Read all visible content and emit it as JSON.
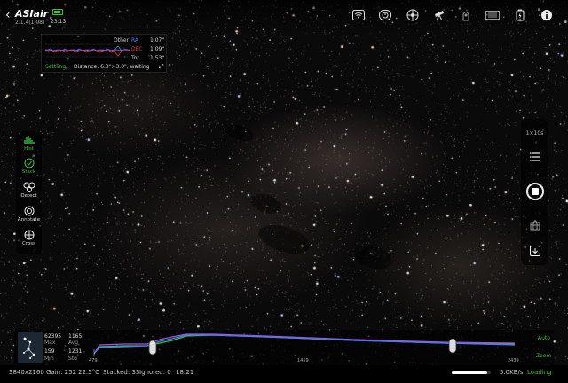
{
  "header": {
    "back_glyph": "‹",
    "brand": "ASIair",
    "version": "2.1.4(1.08)",
    "time": "23:13",
    "icons": [
      "wifi-icon",
      "power-icon",
      "guide-icon",
      "telescope-icon",
      "camera-icon",
      "cooling-icon",
      "battery-device-icon",
      "info-icon"
    ]
  },
  "guide": {
    "labels": {
      "other": "Other",
      "ra": "RA",
      "dec": "DEC",
      "tot": "Tot"
    },
    "values": {
      "other": "1.07\"",
      "ra": "1.09\"",
      "dec": "1.53\""
    },
    "status": "Settling",
    "distance": "Distance: 6.3\">3.0\", waiting",
    "colors": {
      "ra": "#3b82f6",
      "dec": "#e53935",
      "ok": "#3fbf3f"
    }
  },
  "left_tools": [
    {
      "label": "Hist",
      "icon": "histogram-icon",
      "active": true
    },
    {
      "label": "Stack",
      "icon": "stack-icon",
      "active": true
    },
    {
      "label": "Detect",
      "icon": "detect-icon",
      "active": false
    },
    {
      "label": "Annotate",
      "icon": "annotate-icon",
      "active": false
    },
    {
      "label": "Cross",
      "icon": "crosshair-icon",
      "active": false
    }
  ],
  "right_tools": {
    "top_label": "1×10s",
    "icons": [
      "list-icon",
      "stop-shutter-icon",
      "grid-icon",
      "download-icon"
    ]
  },
  "histogram": {
    "max_value": "62395",
    "max_label": "Max",
    "avg_value": "1165",
    "avg_label": "Avg",
    "min_value": "159",
    "min_label": "Min",
    "std_value": "1231",
    "std_label": "Std",
    "ticks": [
      "479",
      "1459",
      "2439"
    ],
    "auto": "Auto",
    "zoom": "Zoom"
  },
  "status": {
    "resolution": "3840x2160",
    "gain": "Gain: 252",
    "temp": "22.5°C",
    "stacked": "Stacked: 33",
    "ignored": "Ignored: 0",
    "elapsed": "18:21",
    "speed": "5.0KB/s",
    "state": "Loading",
    "progress": 0.9
  }
}
